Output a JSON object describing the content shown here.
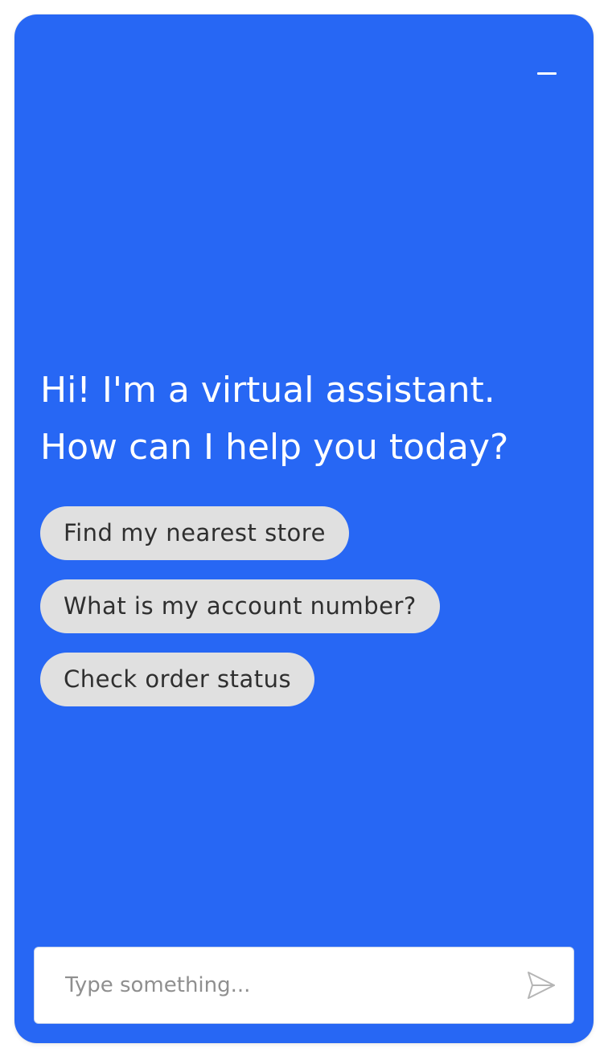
{
  "header": {
    "minimize_icon": "minimize-icon"
  },
  "greeting": {
    "text": "Hi! I'm a virtual assistant. How can I help you today?"
  },
  "suggestions": [
    {
      "label": "Find my nearest store"
    },
    {
      "label": "What is my account number?"
    },
    {
      "label": "Check order status"
    }
  ],
  "composer": {
    "placeholder": "Type something...",
    "value": "",
    "send_icon": "send-icon"
  },
  "colors": {
    "panel_background": "#2767f4",
    "chip_background": "#e0e0e0",
    "chip_text": "#2f2f2f",
    "greeting_text": "#ffffff",
    "placeholder_text": "#8f8f8f"
  }
}
